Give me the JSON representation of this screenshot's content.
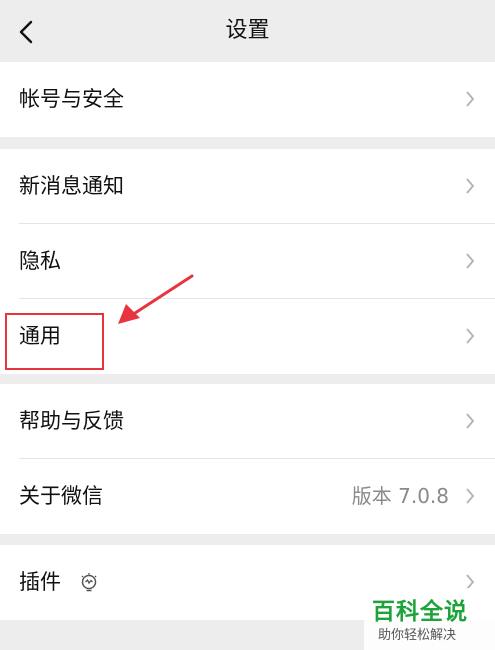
{
  "header": {
    "title": "设置",
    "back_icon": "chevron-left-icon"
  },
  "groups": [
    {
      "items": [
        {
          "label": "帐号与安全"
        }
      ]
    },
    {
      "items": [
        {
          "label": "新消息通知"
        },
        {
          "label": "隐私"
        },
        {
          "label": "通用"
        }
      ]
    },
    {
      "items": [
        {
          "label": "帮助与反馈"
        },
        {
          "label": "关于微信",
          "value": "版本 7.0.8"
        }
      ]
    },
    {
      "items": [
        {
          "label": "插件",
          "icon": "plugin-bulb-icon"
        }
      ]
    }
  ],
  "annotation": {
    "highlight_color": "#e8343f",
    "target": "通用"
  },
  "watermark": {
    "title": "百科全说",
    "subtitle": "助你轻松解决",
    "color": "#1ea33b"
  }
}
